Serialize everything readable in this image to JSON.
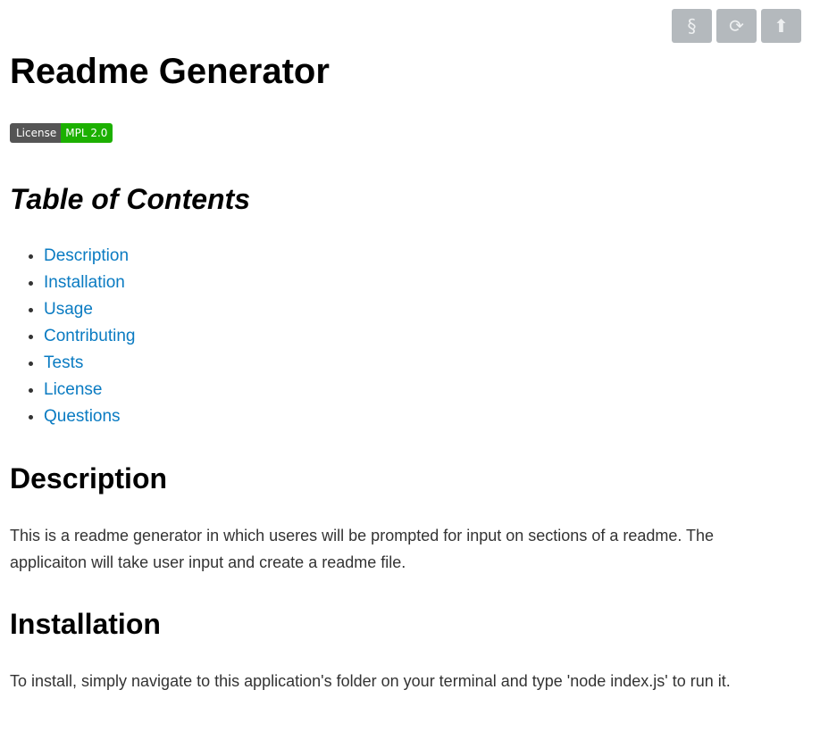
{
  "toolbar": {
    "buttons": [
      {
        "icon": "section-sign-icon",
        "glyph": "§"
      },
      {
        "icon": "refresh-icon",
        "glyph": "⟳"
      },
      {
        "icon": "arrow-up-icon",
        "glyph": "⬆"
      }
    ]
  },
  "title": "Readme Generator",
  "badge": {
    "label": "License",
    "value": "MPL 2.0",
    "label_color": "#555555",
    "value_color": "#1cb000"
  },
  "toc": {
    "heading": "Table of Contents",
    "items": [
      "Description",
      "Installation",
      "Usage",
      "Contributing",
      "Tests",
      "License",
      "Questions"
    ]
  },
  "sections": {
    "description": {
      "heading": "Description",
      "text": "This is a readme generator in which useres will be prompted for input on sections of a readme. The applicaiton will take user input and create a readme file."
    },
    "installation": {
      "heading": "Installation",
      "text": "To install, simply navigate to this application's folder on your terminal and type 'node index.js' to run it."
    }
  },
  "colors": {
    "link": "#0a7bc2",
    "toolbar_button": "#b4b9bd"
  }
}
